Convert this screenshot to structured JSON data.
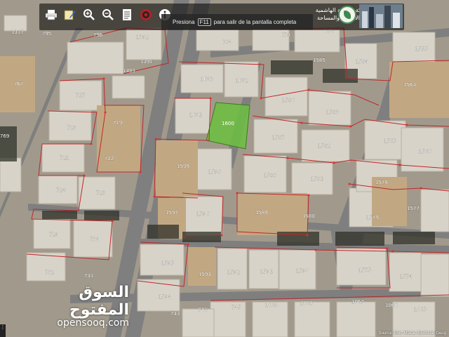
{
  "toolbar": {
    "icons": [
      "printer-icon",
      "draw-icon",
      "zoom-in-icon",
      "zoom-out-icon",
      "document-icon",
      "target-icon",
      "info-icon"
    ],
    "fullscreen_pre": "Presiona",
    "fullscreen_key": "F11",
    "fullscreen_post": "para salir de la pantalla completa",
    "ministry_line1": "المملكة الأردنية الهاشمية",
    "ministry_line2": "دائرة الأراضي والمساحة"
  },
  "parcels": [
    {
      "id": "1317"
    },
    {
      "id": "795"
    },
    {
      "id": "796"
    },
    {
      "id": "1392"
    },
    {
      "id": "684"
    },
    {
      "id": "679"
    },
    {
      "id": "676"
    },
    {
      "id": "1555"
    },
    {
      "id": "767"
    },
    {
      "id": "1493"
    },
    {
      "id": "1391"
    },
    {
      "id": "1585"
    },
    {
      "id": "1584"
    },
    {
      "id": "717"
    },
    {
      "id": "1603"
    },
    {
      "id": "1602"
    },
    {
      "id": "1586"
    },
    {
      "id": "1564"
    },
    {
      "id": "720"
    },
    {
      "id": "719"
    },
    {
      "id": "1601"
    },
    {
      "id": "1600"
    },
    {
      "id": "1583"
    },
    {
      "id": "769"
    },
    {
      "id": "721"
    },
    {
      "id": "722"
    },
    {
      "id": "1587"
    },
    {
      "id": "1582"
    },
    {
      "id": "1565"
    },
    {
      "id": "1566"
    },
    {
      "id": "1599"
    },
    {
      "id": "1598"
    },
    {
      "id": "1588"
    },
    {
      "id": "1581"
    },
    {
      "id": "1578"
    },
    {
      "id": "724"
    },
    {
      "id": "723"
    },
    {
      "id": "1597"
    },
    {
      "id": "1589"
    },
    {
      "id": "1580"
    },
    {
      "id": "1577"
    },
    {
      "id": "1579"
    },
    {
      "id": "729"
    },
    {
      "id": "730"
    },
    {
      "id": "1596"
    },
    {
      "id": "1595"
    },
    {
      "id": "1593"
    },
    {
      "id": "1592"
    },
    {
      "id": "1591"
    },
    {
      "id": "1590"
    },
    {
      "id": "1575"
    },
    {
      "id": "1574"
    },
    {
      "id": "732"
    },
    {
      "id": "731"
    },
    {
      "id": "1594"
    },
    {
      "id": "743"
    },
    {
      "id": "744"
    },
    {
      "id": "745"
    },
    {
      "id": "1069"
    },
    {
      "id": "1068"
    },
    {
      "id": "1067"
    },
    {
      "id": "1066"
    },
    {
      "id": "1065"
    }
  ],
  "selected_parcel": "1600",
  "watermark": {
    "arabic": "السوق المفتوح",
    "latin": "opensooq.com"
  },
  "source": "Source: Esri, Maxar, Earthstar Geog",
  "colors": {
    "boundary": "#c0262b",
    "selected_fill": "#6bbf3f",
    "road": "#8e8e8e"
  }
}
